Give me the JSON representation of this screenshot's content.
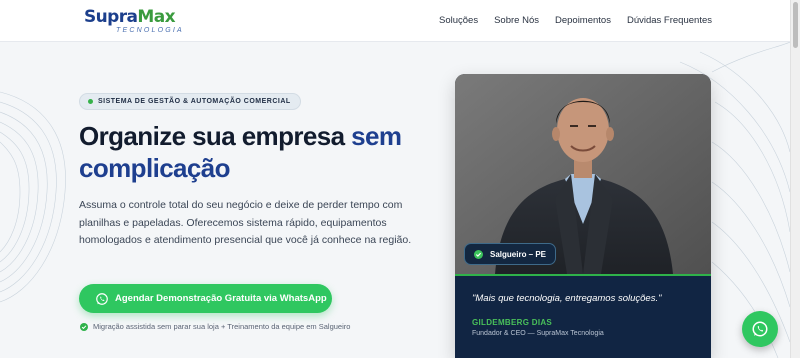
{
  "brand": {
    "name_part1": "Supra",
    "name_part2": "Max",
    "subtitle": "TECNOLOGIA"
  },
  "nav": {
    "items": [
      "Soluções",
      "Sobre Nós",
      "Depoimentos",
      "Dúvidas Frequentes"
    ]
  },
  "hero": {
    "badge": "SISTEMA DE GESTÃO & AUTOMAÇÃO COMERCIAL",
    "headline_part1": "Organize sua empresa ",
    "headline_accent": "sem",
    "headline_part2": "complicação",
    "description": "Assuma o controle total do seu negócio e deixe de perder tempo com planilhas e papeladas. Oferecemos sistema rápido, equipamentos homologados e atendimento presencial que você já conhece na região.",
    "cta_label": "Agendar Demonstração Gratuita via WhatsApp",
    "cta_icon": "whatsapp-icon",
    "note": "Migração assistida sem parar sua loja + Treinamento da equipe em Salgueiro"
  },
  "card": {
    "location": "Salgueiro – PE",
    "quote": "\"Mais que tecnologia, entregamos soluções.\"",
    "author": "GILDEMBERG DIAS",
    "role": "Fundador & CEO — SupraMax Tecnologia"
  },
  "colors": {
    "brand_blue": "#1e3f8f",
    "brand_green": "#3a9b3e",
    "cta_green": "#2fc760",
    "card_navy": "#112543"
  }
}
